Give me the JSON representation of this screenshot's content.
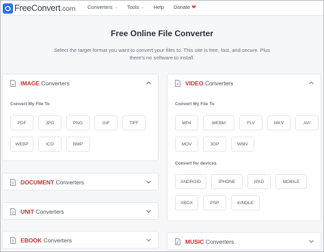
{
  "header": {
    "logo_name": "FreeConvert",
    "logo_tld": ".com",
    "nav": [
      {
        "label": "Converters",
        "has_dropdown": true
      },
      {
        "label": "Tools",
        "has_dropdown": true
      },
      {
        "label": "Help",
        "has_dropdown": false
      },
      {
        "label": "Donate",
        "has_dropdown": false
      }
    ],
    "dropdown_glyph": "⌄",
    "heart_glyph": "❤"
  },
  "main": {
    "title": "Free Online File Converter",
    "intro": "Select the target format you want to convert your files to. This site is free, fast, and secure. Plus there's no software to install."
  },
  "panels": {
    "image": {
      "accent": "IMAGE",
      "rest": " Converters",
      "expanded": true,
      "group_label": "Convert My File To",
      "formats": [
        "PDF",
        "JPG",
        "PNG",
        "GIF",
        "TIFF",
        "WEBP",
        "ICO",
        "BMP"
      ]
    },
    "video": {
      "accent": "VIDEO",
      "rest": " Converters",
      "expanded": true,
      "group_label": "Convert My File To",
      "formats": [
        "MP4",
        "WEBM",
        "FLV",
        "MKV",
        "AVI",
        "MOV",
        "3GP",
        "WMV"
      ],
      "devices_label": "Convert for devices",
      "devices": [
        "ANDROID",
        "IPHONE",
        "IPAD",
        "MOBILE",
        "XBOX",
        "PSP",
        "KINDLE"
      ]
    },
    "document": {
      "accent": "DOCUMENT",
      "rest": " Converters",
      "expanded": false
    },
    "unit": {
      "accent": "UNIT",
      "rest": " Converters",
      "expanded": false
    },
    "ebook": {
      "accent": "EBOOK",
      "rest": " Converters",
      "expanded": false
    },
    "music": {
      "accent": "MUSIC",
      "rest": " Converters",
      "expanded": false
    }
  },
  "colors": {
    "accent": "#c22f2f",
    "brand": "#2f6fe4",
    "background": "#f6f7f9"
  },
  "icons": {
    "logo": "freeconvert-logo-icon",
    "category": "file-document-icon",
    "collapse": "chevron-up-icon",
    "expand": "chevron-down-icon"
  }
}
